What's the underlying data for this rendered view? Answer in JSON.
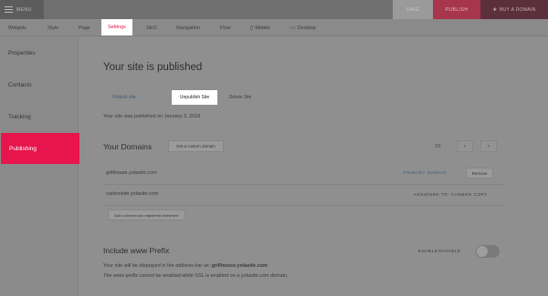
{
  "topbar": {
    "menu_label": "MENU",
    "save_label": "SAVE",
    "publish_label": "PUBLISH",
    "buy_domain_label": "BUY A DOMAIN"
  },
  "nav": {
    "items": [
      {
        "label": "Widgets"
      },
      {
        "label": "Style"
      },
      {
        "label": "Page"
      },
      {
        "label": "Settings",
        "active": true
      },
      {
        "label": "SEO"
      },
      {
        "label": "Navigation"
      },
      {
        "label": "Flow"
      },
      {
        "label": "Mobile",
        "icon": "mobile-icon"
      },
      {
        "label": "Desktop",
        "icon": "desktop-icon"
      }
    ]
  },
  "sidebar": {
    "items": [
      {
        "label": "Properties"
      },
      {
        "label": "Contacts"
      },
      {
        "label": "Tracking"
      },
      {
        "label": "Publishing",
        "active": true
      }
    ]
  },
  "main": {
    "title": "Your site is published",
    "segments": [
      "Publish site",
      "Unpublish Site",
      "Delete Site"
    ],
    "published_note": "Your site was published on January 3, 2018"
  },
  "domains": {
    "title": "Your Domains",
    "custom_domain_btn": "Get a custom domain",
    "pager_count": "1/1",
    "pager_prev": "‹",
    "pager_next": "›",
    "rows": [
      {
        "name": "grillhouse.yolasite.com",
        "action_link": "PRIMARY DOMAIN",
        "remove_label": "Remove"
      },
      {
        "name": "carbonsite.yolasite.com",
        "assigned": "ASSIGNED TO: CARBON COPY"
      }
    ],
    "add_owned_btn": "Add a domain you registered elsewhere"
  },
  "www_prefix": {
    "title": "Include www Prefix",
    "toggle_label": "ENABLE/DISABLE",
    "line1_prefix": "Your site will be displayed in the address bar as:",
    "line1_domain": "grillhouse.yolasite.com",
    "line2": "The www prefix cannot be enabled while SSL is enabled on a yolasite.com domain."
  },
  "colors": {
    "accent": "#e8144c",
    "overlay_bg": "#8f8f8f"
  }
}
